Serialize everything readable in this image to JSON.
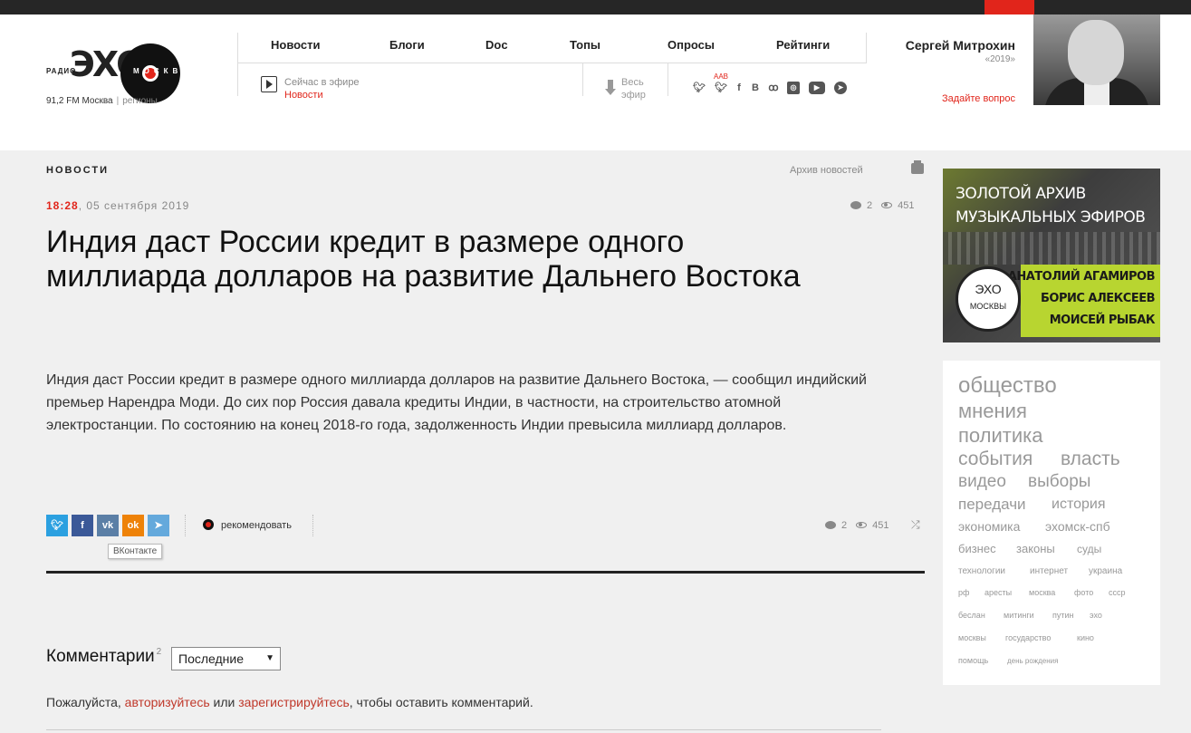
{
  "header": {
    "logo": {
      "radio": "РАДИО",
      "echo": "ЭХО",
      "moskvy": "МОСКВЫ",
      "frequency": "91,2 FM Москва",
      "regions": "регионы"
    },
    "nav": [
      "Новости",
      "Блоги",
      "Doc",
      "Топы",
      "Опросы",
      "Рейтинги"
    ],
    "on_air_label": "Сейчас в эфире",
    "on_air_show": "Новости",
    "all_air": "Весь эфир",
    "aab": "AAB",
    "socials": [
      "twitter-icon",
      "twitter-icon",
      "facebook-icon",
      "vk-icon",
      "odnoklassniki-icon",
      "instagram-icon",
      "youtube-icon",
      "telegram-icon"
    ],
    "guest": {
      "name": "Сергей Митрохин",
      "year": "«2019»",
      "ask": "Задайте вопрос"
    }
  },
  "article": {
    "section": "НОВОСТИ",
    "archive": "Архив новостей",
    "time": "18:28",
    "date": ", 05 сентября 2019",
    "comments_count": "2",
    "views": "451",
    "title": "Индия даст России кредит в размере одного миллиарда долларов на развитие Дальнего Востока",
    "body": "Индия даст России кредит в размере одного миллиарда долларов на развитие Дальнего Востока, — сообщил индийский премьер Нарендра Моди. До сих пор Россия давала кредиты Индии, в частности, на строительство атомной электростанции. По состоянию на конец 2018-го года, задолженность Индии превысила миллиард долларов.",
    "share_buttons": [
      "twitter",
      "facebook",
      "vk",
      "odnoklassniki",
      "telegram"
    ],
    "recommend": "рекомендовать",
    "tooltip": "ВКонтакте"
  },
  "comments": {
    "title": "Комментарии",
    "count": "2",
    "sort": "Последние",
    "login_prefix": "Пожалуйста, ",
    "login_link": "авторизуйтесь",
    "login_or": " или ",
    "register_link": "зарегистрируйтесь",
    "login_suffix": ", чтобы оставить комментарий."
  },
  "banner": {
    "line1": "ЗОЛОТОЙ АРХИВ",
    "line2": "МУЗЫКАЛЬНЫХ ЭФИРОВ",
    "names": [
      "АНАТОЛИЙ АГАМИРОВ",
      "БОРИС АЛЕКСЕЕВ",
      "МОИСЕЙ РЫБАК"
    ],
    "badge_echo": "ЭХО",
    "badge_moskvy": "МОСКВЫ"
  },
  "tags": [
    "общество",
    "мнения",
    "политика",
    "события",
    "власть",
    "видео",
    "выборы",
    "передачи",
    "история",
    "экономика",
    "эхомск-спб",
    "бизнес",
    "законы",
    "суды",
    "технологии",
    "интернет",
    "украина",
    "рф",
    "аресты",
    "москва",
    "фото",
    "ссср",
    "беслан",
    "митинги",
    "путин",
    "эхо",
    "москвы",
    "государство",
    "кино",
    "помощь",
    "день рождения"
  ],
  "colors": {
    "accent": "#e1251b",
    "dark": "#262626",
    "background": "#f0f0f0"
  }
}
